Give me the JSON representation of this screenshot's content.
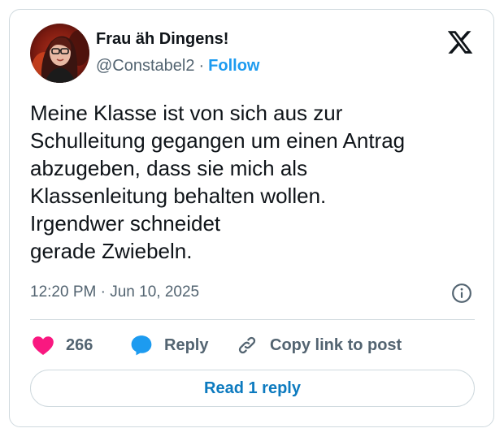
{
  "author": {
    "display_name": "Frau äh Dingens!",
    "handle": "@Constabel2",
    "separator": "·",
    "follow_label": "Follow"
  },
  "tweet": {
    "lines": [
      "Meine Klasse ist von sich aus zur",
      "Schulleitung gegangen um einen Antrag",
      "abzugeben, dass sie mich als",
      "Klassenleitung behalten wollen.",
      "Irgendwer schneidet",
      "gerade Zwiebeln."
    ],
    "timestamp": "12:20 PM · Jun 10, 2025"
  },
  "actions": {
    "like_count": "266",
    "reply_label": "Reply",
    "copy_link_label": "Copy link to post"
  },
  "read_replies_label": "Read 1 reply",
  "icons": {
    "brand": "x-logo-icon",
    "info": "info-icon",
    "like": "heart-icon",
    "reply": "speech-bubble-icon",
    "copy": "link-icon"
  },
  "colors": {
    "like": "#f91880",
    "reply": "#1d9bf0",
    "follow": "#1d9bf0",
    "read_reply": "#0c7abf",
    "secondary_text": "#536471",
    "border": "#cfd9de"
  }
}
